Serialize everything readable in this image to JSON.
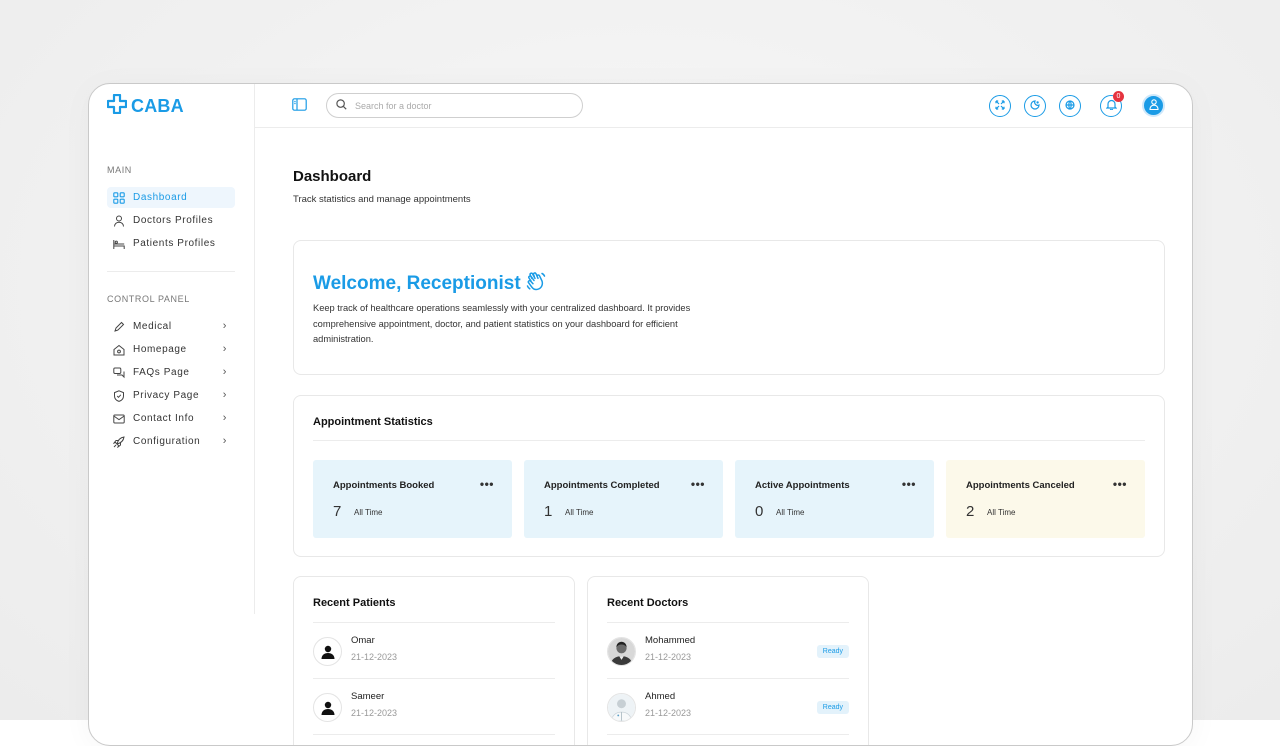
{
  "app": {
    "logo_text": "CABA",
    "brand_color": "#1a9be6"
  },
  "sidebar": {
    "main_label": "MAIN",
    "main_items": [
      {
        "label": "Dashboard",
        "icon": "dashboard-grid-icon",
        "active": true
      },
      {
        "label": "Doctors Profiles",
        "icon": "doctor-icon"
      },
      {
        "label": "Patients Profiles",
        "icon": "bed-icon"
      }
    ],
    "control_label": "CONTROL PANEL",
    "control_items": [
      {
        "label": "Medical",
        "icon": "pen-icon"
      },
      {
        "label": "Homepage",
        "icon": "home-icon"
      },
      {
        "label": "FAQs Page",
        "icon": "chat-icon"
      },
      {
        "label": "Privacy Page",
        "icon": "shield-icon"
      },
      {
        "label": "Contact Info",
        "icon": "mail-icon"
      },
      {
        "label": "Configuration",
        "icon": "rocket-icon"
      }
    ]
  },
  "topbar": {
    "search_placeholder": "Search for a doctor",
    "notification_count": "0",
    "icons": [
      "fullscreen-icon",
      "theme-toggle-icon",
      "language-globe-icon",
      "notification-bell-icon",
      "user-avatar-icon"
    ]
  },
  "main": {
    "title": "Dashboard",
    "subtitle": "Track statistics and manage appointments",
    "welcome": {
      "title": "Welcome, Receptionist",
      "text": "Keep track of healthcare operations seamlessly with your centralized dashboard. It provides comprehensive appointment, doctor, and patient statistics on your dashboard for efficient administration."
    },
    "stats": {
      "heading": "Appointment Statistics",
      "items": [
        {
          "title": "Appointments Booked",
          "value": "7",
          "period": "All Time"
        },
        {
          "title": "Appointments Completed",
          "value": "1",
          "period": "All Time"
        },
        {
          "title": "Active Appointments",
          "value": "0",
          "period": "All Time"
        },
        {
          "title": "Appointments Canceled",
          "value": "2",
          "period": "All Time"
        }
      ],
      "more_label": "•••"
    },
    "recent_patients": {
      "heading": "Recent Patients",
      "rows": [
        {
          "name": "Omar",
          "date": "21-12-2023"
        },
        {
          "name": "Sameer",
          "date": "21-12-2023"
        }
      ]
    },
    "recent_doctors": {
      "heading": "Recent Doctors",
      "rows": [
        {
          "name": "Mohammed",
          "date": "21-12-2023",
          "status": "Ready"
        },
        {
          "name": "Ahmed",
          "date": "21-12-2023",
          "status": "Ready"
        }
      ]
    }
  }
}
